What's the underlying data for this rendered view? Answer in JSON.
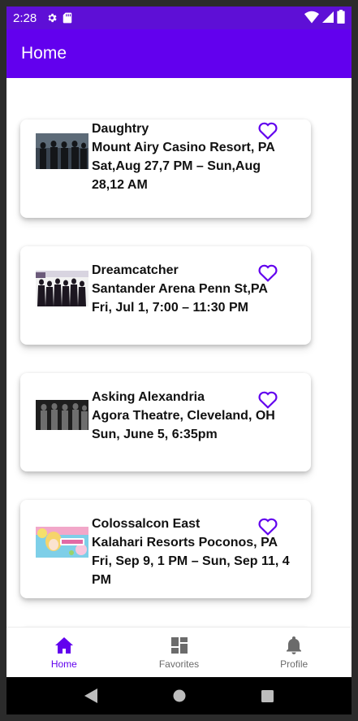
{
  "status_bar": {
    "time": "2:28",
    "icons_left": [
      "gear-icon",
      "sd-card-icon"
    ],
    "icons_right": [
      "wifi-icon",
      "signal-icon",
      "battery-icon"
    ]
  },
  "app_bar": {
    "title": "Home"
  },
  "events": [
    {
      "name": "Daughtry",
      "venue": "Mount Airy Casino Resort, PA",
      "datetime": "Sat,Aug 27,7 PM – Sun,Aug 28,12 AM",
      "favorite_icon": "heart-outline-icon"
    },
    {
      "name": "Dreamcatcher",
      "venue": "Santander Arena Penn St,PA",
      "datetime": "Fri, Jul 1, 7:00 – 11:30 PM",
      "favorite_icon": "heart-outline-icon"
    },
    {
      "name": "Asking Alexandria",
      "venue": "Agora Theatre, Cleveland, OH",
      "datetime": "Sun, June 5, 6:35pm",
      "favorite_icon": "heart-outline-icon"
    },
    {
      "name": "Colossalcon East",
      "venue": "Kalahari Resorts Poconos, PA",
      "datetime": "Fri, Sep 9, 1 PM – Sun, Sep 11, 4 PM",
      "favorite_icon": "heart-outline-icon"
    }
  ],
  "bottom_nav": {
    "items": [
      {
        "label": "Home",
        "icon": "home-icon",
        "active": true
      },
      {
        "label": "Favorites",
        "icon": "dashboard-icon",
        "active": false
      },
      {
        "label": "Profile",
        "icon": "bell-icon",
        "active": false
      }
    ]
  },
  "colors": {
    "primary": "#6200ee",
    "status_bar": "#5e0fd6",
    "heart": "#6200ee",
    "nav_inactive": "#6b6b6b"
  }
}
